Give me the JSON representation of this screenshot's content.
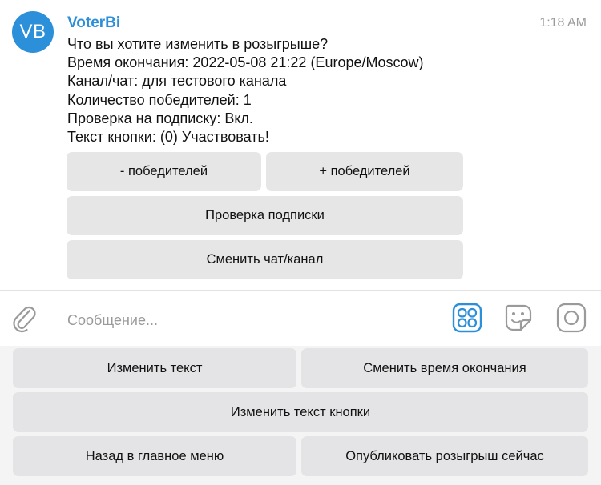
{
  "message": {
    "avatar_initials": "VB",
    "sender": "VoterBi",
    "time": "1:18 AM",
    "lines": [
      "Что вы хотите изменить в розыгрыше?",
      "Время окончания: 2022-05-08 21:22 (Europe/Moscow)",
      "Канал/чат: для тестового канала",
      "Количество победителей: 1",
      "Проверка на подписку: Вкл.",
      "Текст кнопки: (0) Участвовать!"
    ],
    "inline_buttons": {
      "minus_winners": "- победителей",
      "plus_winners": "+ победителей",
      "check_subscription": "Проверка подписки",
      "change_chat": "Сменить чат/канал"
    }
  },
  "composer": {
    "placeholder": "Сообщение...",
    "icons": [
      "paperclip-icon",
      "bot-keyboard-icon",
      "sticker-icon",
      "camera-icon"
    ]
  },
  "keyboard": {
    "change_text": "Изменить текст",
    "change_end_time": "Сменить время окончания",
    "change_button_text": "Изменить текст кнопки",
    "back_main_menu": "Назад в главное меню",
    "publish_now": "Опубликовать розыгрыш сейчас"
  },
  "colors": {
    "accent": "#2b8fd9",
    "button_bg": "#e6e6e6",
    "keyboard_bg": "#f4f4f5"
  }
}
